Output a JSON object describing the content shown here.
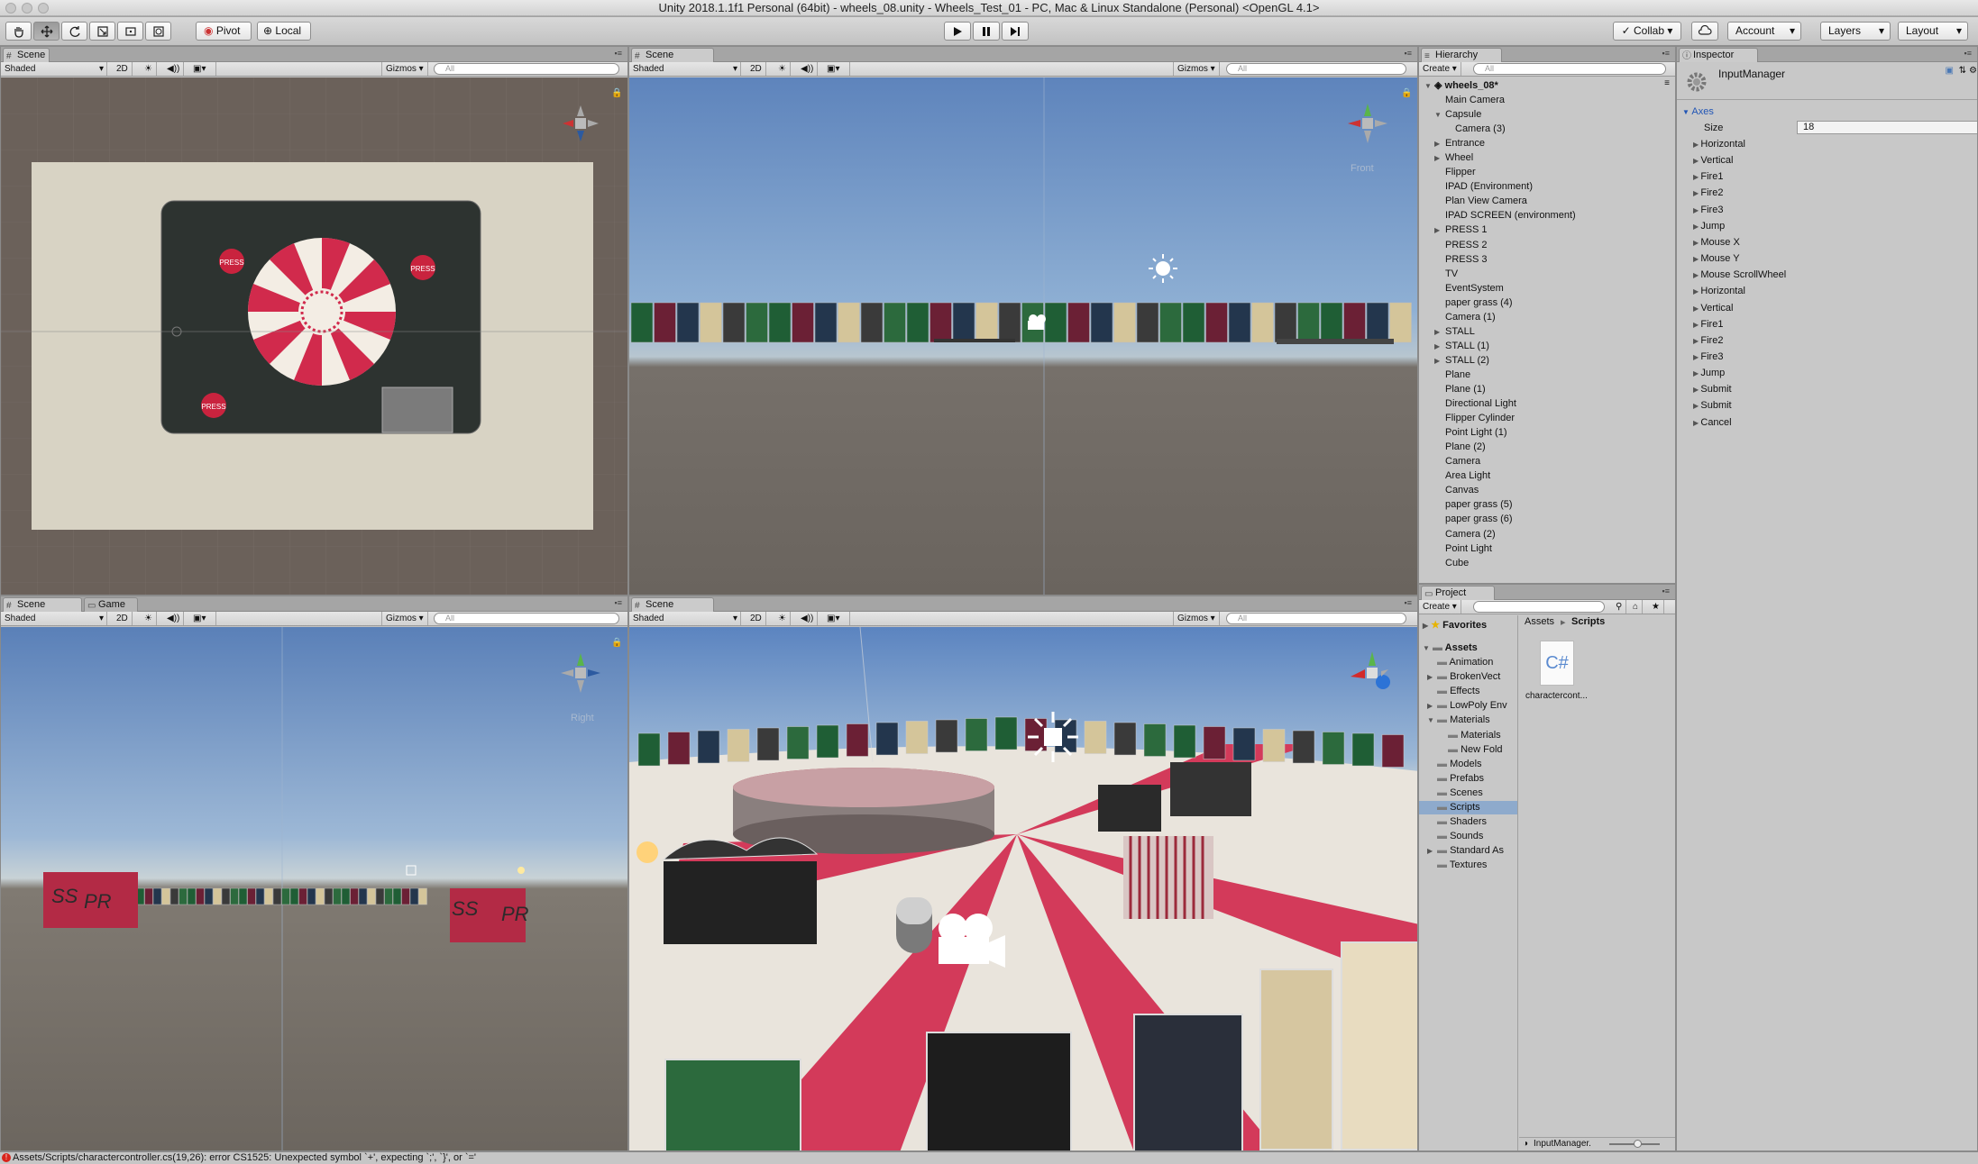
{
  "window": {
    "title": "Unity 2018.1.1f1 Personal (64bit) - wheels_08.unity - Wheels_Test_01 - PC, Mac & Linux Standalone (Personal) <OpenGL 4.1>"
  },
  "toolbar": {
    "pivot": "Pivot",
    "local": "Local",
    "collab": "Collab",
    "account": "Account",
    "layers": "Layers",
    "layout": "Layout"
  },
  "scene_common": {
    "shaded": "Shaded",
    "two_d": "2D",
    "gizmos": "Gizmos",
    "search_placeholder": "All"
  },
  "panels": {
    "top_left": {
      "tab": "Scene"
    },
    "top_mid": {
      "tab": "Scene",
      "axis_label": "Front"
    },
    "bottom_left": {
      "tab": "Scene",
      "tab2": "Game",
      "axis_label": "Right"
    },
    "bottom_mid": {
      "tab": "Scene"
    }
  },
  "scene_labels": {
    "press": "PRESS",
    "ss": "SS",
    "pr": "PR"
  },
  "hierarchy": {
    "tab": "Hierarchy",
    "create": "Create",
    "search_placeholder": "All",
    "scene": "wheels_08*",
    "items": [
      {
        "label": "Main Camera",
        "indent": 1,
        "arrow": ""
      },
      {
        "label": "Capsule",
        "indent": 1,
        "arrow": "down"
      },
      {
        "label": "Camera (3)",
        "indent": 2,
        "arrow": ""
      },
      {
        "label": "Entrance",
        "indent": 1,
        "arrow": "right"
      },
      {
        "label": "Wheel",
        "indent": 1,
        "arrow": "right"
      },
      {
        "label": "Flipper",
        "indent": 1,
        "arrow": ""
      },
      {
        "label": "IPAD (Environment)",
        "indent": 1,
        "arrow": ""
      },
      {
        "label": "Plan View Camera",
        "indent": 1,
        "arrow": ""
      },
      {
        "label": "IPAD SCREEN (environment)",
        "indent": 1,
        "arrow": ""
      },
      {
        "label": "PRESS 1",
        "indent": 1,
        "arrow": "right"
      },
      {
        "label": "PRESS 2",
        "indent": 1,
        "arrow": ""
      },
      {
        "label": "PRESS 3",
        "indent": 1,
        "arrow": ""
      },
      {
        "label": "TV",
        "indent": 1,
        "arrow": ""
      },
      {
        "label": "EventSystem",
        "indent": 1,
        "arrow": ""
      },
      {
        "label": "paper grass (4)",
        "indent": 1,
        "arrow": ""
      },
      {
        "label": "Camera (1)",
        "indent": 1,
        "arrow": ""
      },
      {
        "label": "STALL",
        "indent": 1,
        "arrow": "right"
      },
      {
        "label": "STALL (1)",
        "indent": 1,
        "arrow": "right"
      },
      {
        "label": "STALL (2)",
        "indent": 1,
        "arrow": "right"
      },
      {
        "label": "Plane",
        "indent": 1,
        "arrow": ""
      },
      {
        "label": "Plane (1)",
        "indent": 1,
        "arrow": ""
      },
      {
        "label": "Directional Light",
        "indent": 1,
        "arrow": ""
      },
      {
        "label": "Flipper Cylinder",
        "indent": 1,
        "arrow": ""
      },
      {
        "label": "Point Light (1)",
        "indent": 1,
        "arrow": ""
      },
      {
        "label": "Plane (2)",
        "indent": 1,
        "arrow": ""
      },
      {
        "label": "Camera",
        "indent": 1,
        "arrow": ""
      },
      {
        "label": "Area Light",
        "indent": 1,
        "arrow": ""
      },
      {
        "label": "Canvas",
        "indent": 1,
        "arrow": ""
      },
      {
        "label": "paper grass (5)",
        "indent": 1,
        "arrow": ""
      },
      {
        "label": "paper grass (6)",
        "indent": 1,
        "arrow": ""
      },
      {
        "label": "Camera (2)",
        "indent": 1,
        "arrow": ""
      },
      {
        "label": "Point Light",
        "indent": 1,
        "arrow": ""
      },
      {
        "label": "Cube",
        "indent": 1,
        "arrow": ""
      }
    ]
  },
  "inspector": {
    "tab": "Inspector",
    "object": "InputManager",
    "section": "Axes",
    "size_label": "Size",
    "size_value": "18",
    "axes": [
      "Horizontal",
      "Vertical",
      "Fire1",
      "Fire2",
      "Fire3",
      "Jump",
      "Mouse X",
      "Mouse Y",
      "Mouse ScrollWheel",
      "Horizontal",
      "Vertical",
      "Fire1",
      "Fire2",
      "Fire3",
      "Jump",
      "Submit",
      "Submit",
      "Cancel"
    ]
  },
  "project": {
    "tab": "Project",
    "create": "Create",
    "favorites": "Favorites",
    "assets_root": "Assets",
    "breadcrumb": [
      "Assets",
      "Scripts"
    ],
    "folders": [
      {
        "label": "Animation",
        "indent": 1,
        "arrow": ""
      },
      {
        "label": "BrokenVect",
        "indent": 1,
        "arrow": "right"
      },
      {
        "label": "Effects",
        "indent": 1,
        "arrow": ""
      },
      {
        "label": "LowPoly Env",
        "indent": 1,
        "arrow": "right"
      },
      {
        "label": "Materials",
        "indent": 1,
        "arrow": "down"
      },
      {
        "label": "Materials",
        "indent": 2,
        "arrow": ""
      },
      {
        "label": "New Fold",
        "indent": 2,
        "arrow": ""
      },
      {
        "label": "Models",
        "indent": 1,
        "arrow": ""
      },
      {
        "label": "Prefabs",
        "indent": 1,
        "arrow": ""
      },
      {
        "label": "Scenes",
        "indent": 1,
        "arrow": ""
      },
      {
        "label": "Scripts",
        "indent": 1,
        "arrow": "",
        "selected": true
      },
      {
        "label": "Shaders",
        "indent": 1,
        "arrow": ""
      },
      {
        "label": "Sounds",
        "indent": 1,
        "arrow": ""
      },
      {
        "label": "Standard As",
        "indent": 1,
        "arrow": "right"
      },
      {
        "label": "Textures",
        "indent": 1,
        "arrow": ""
      }
    ],
    "file": {
      "icon_text": "C#",
      "name": "charactercont..."
    },
    "selected_file": "InputManager."
  },
  "status": {
    "error": "Assets/Scripts/charactercontroller.cs(19,26): error CS1525: Unexpected symbol `+', expecting `;', `}', or `='"
  }
}
